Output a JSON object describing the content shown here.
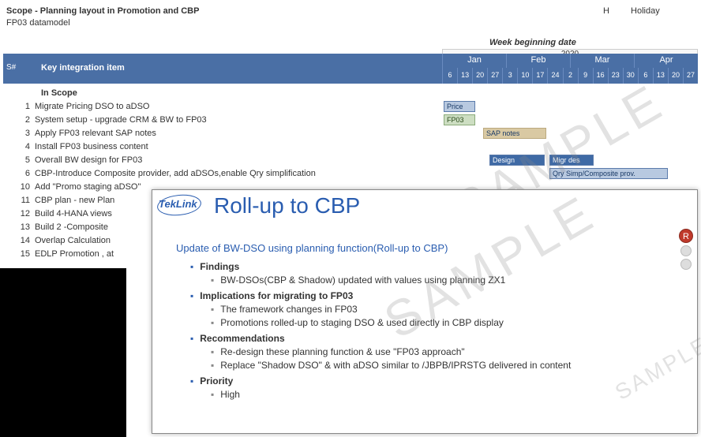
{
  "sheet": {
    "title": "Scope - Planning layout in Promotion and CBP",
    "subtitle": "FP03 datamodel",
    "holiday_code": "H",
    "holiday_label": "Holiday",
    "week_beginning": "Week beginning date",
    "year": "2020",
    "header_sn": "S#",
    "header_item": "Key integration item",
    "months": [
      "Jan",
      "Feb",
      "Mar",
      "Apr"
    ],
    "days": [
      "6",
      "13",
      "20",
      "27",
      "3",
      "10",
      "17",
      "24",
      "2",
      "9",
      "16",
      "23",
      "30",
      "6",
      "13",
      "20",
      "27"
    ],
    "in_scope_heading": "In Scope",
    "rows": [
      {
        "n": "1",
        "t": "Migrate Pricing DSO to aDSO"
      },
      {
        "n": "2",
        "t": "System setup - upgrade CRM & BW to FP03"
      },
      {
        "n": "3",
        "t": "Apply FP03 relevant  SAP notes"
      },
      {
        "n": "4",
        "t": "Install FP03 business content"
      },
      {
        "n": "5",
        "t": "Overall BW design for FP03"
      },
      {
        "n": "6",
        "t": "CBP-Introduce Composite provider, add aDSOs,enable Qry simplification"
      },
      {
        "n": "10",
        "t": "Add \"Promo staging aDSO\""
      },
      {
        "n": "11",
        "t": "CBP plan - new Plan"
      },
      {
        "n": "12",
        "t": "Build 4-HANA views"
      },
      {
        "n": "13",
        "t": "Build 2 -Composite"
      },
      {
        "n": "14",
        "t": "Overlap Calculation"
      },
      {
        "n": "15",
        "t": "EDLP Promotion , at"
      }
    ],
    "bars": {
      "price": "Price",
      "fp03": "FP03",
      "sapnotes": "SAP notes",
      "design": "Design",
      "migrdes": "Migr des",
      "qry": "Qry Simp/Composite prov."
    }
  },
  "slide": {
    "logo": "TekLink",
    "title": "Roll-up to CBP",
    "subtitle": "Update of BW-DSO using planning function(Roll-up to CBP)",
    "sections": [
      {
        "h": "Findings",
        "items": [
          "BW-DSOs(CBP & Shadow) updated with values using planning ZX1"
        ]
      },
      {
        "h": "Implications for migrating to FP03",
        "items": [
          "The framework changes in FP03",
          "Promotions rolled-up to staging DSO & used directly in CBP display"
        ]
      },
      {
        "h": "Recommendations",
        "items": [
          "Re-design these planning function & use \"FP03 approach\"",
          "Replace  \"Shadow DSO\" & with aDSO similar to /JBPB/IPRSTG delivered in content"
        ]
      },
      {
        "h": "Priority",
        "items": [
          "High"
        ]
      }
    ]
  },
  "watermark": "SAMPLE",
  "traffic_r": "R"
}
